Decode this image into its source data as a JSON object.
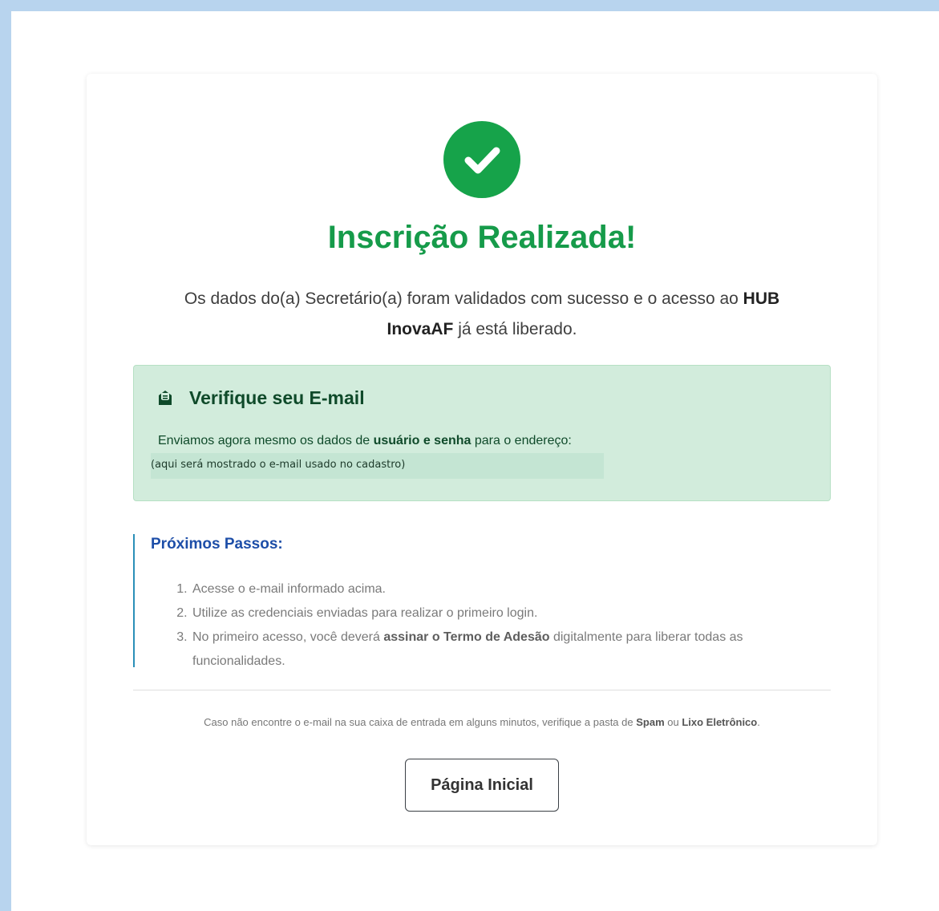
{
  "success": {
    "title": "Inscrição Realizada!",
    "lead_part1": "Os dados do(a) Secretário(a) foram validados com sucesso e o acesso ao ",
    "lead_bold": "HUB InovaAF",
    "lead_part2": " já está liberado."
  },
  "email_box": {
    "title": "Verifique seu E-mail",
    "text_part1": "Enviamos agora mesmo os dados de ",
    "text_bold": "usuário e senha",
    "text_part2": " para o endereço:",
    "email_placeholder": "(aqui será mostrado o e-mail usado no cadastro)"
  },
  "steps": {
    "title": "Próximos Passos:",
    "item1": "Acesse o e-mail informado acima.",
    "item2": "Utilize as credenciais enviadas para realizar o primeiro login.",
    "item3_part1": "No primeiro acesso, você deverá ",
    "item3_bold": "assinar o Termo de Adesão",
    "item3_part2": " digitalmente para liberar todas as funcionalidades."
  },
  "note": {
    "part1": "Caso não encontre o e-mail na sua caixa de entrada em alguns minutos, verifique a pasta de ",
    "spam": "Spam",
    "part2": " ou ",
    "junk": "Lixo Eletrônico",
    "part3": "."
  },
  "home_button_label": "Página Inicial",
  "colors": {
    "success_green": "#169b4a",
    "email_box_bg": "#d2ecdc",
    "steps_title_blue": "#1d4ea8",
    "steps_border": "#2a8fb8"
  },
  "icons": {
    "success": "check-circle-icon",
    "email": "envelope-open-icon"
  }
}
